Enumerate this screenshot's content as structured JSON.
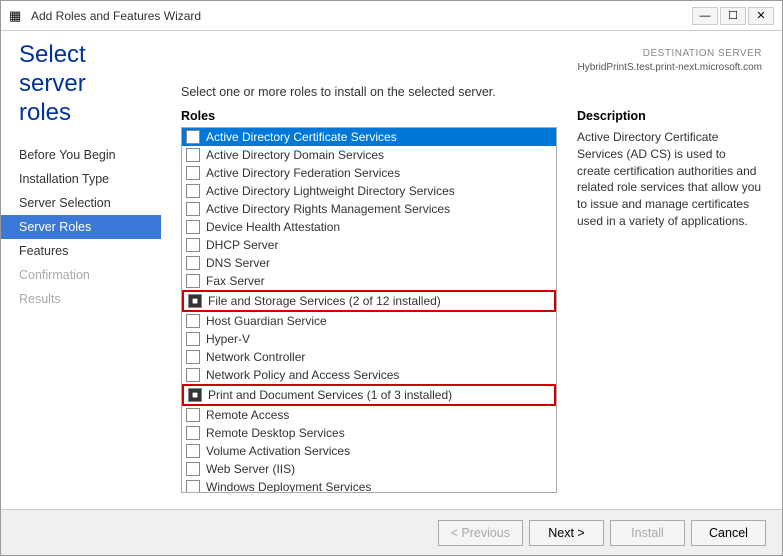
{
  "window": {
    "title": "Add Roles and Features Wizard",
    "title_icon": "▦"
  },
  "title_controls": {
    "minimize": "—",
    "maximize": "☐",
    "close": "✕"
  },
  "destination_server": {
    "label": "DESTINATION SERVER",
    "server": "HybridPrintS.test.print-next.microsoft.com"
  },
  "page_title": "Select server roles",
  "instruction": "Select one or more roles to install on the selected server.",
  "sidebar": {
    "items": [
      {
        "id": "before-you-begin",
        "label": "Before You Begin",
        "state": "normal"
      },
      {
        "id": "installation-type",
        "label": "Installation Type",
        "state": "normal"
      },
      {
        "id": "server-selection",
        "label": "Server Selection",
        "state": "normal"
      },
      {
        "id": "server-roles",
        "label": "Server Roles",
        "state": "active"
      },
      {
        "id": "features",
        "label": "Features",
        "state": "normal"
      },
      {
        "id": "confirmation",
        "label": "Confirmation",
        "state": "disabled"
      },
      {
        "id": "results",
        "label": "Results",
        "state": "disabled"
      }
    ]
  },
  "roles": {
    "column_label": "Roles",
    "items": [
      {
        "id": "ad-cert",
        "label": "Active Directory Certificate Services",
        "checked": false,
        "selected": true
      },
      {
        "id": "ad-domain",
        "label": "Active Directory Domain Services",
        "checked": false,
        "selected": false
      },
      {
        "id": "ad-federation",
        "label": "Active Directory Federation Services",
        "checked": false,
        "selected": false
      },
      {
        "id": "ad-lightweight",
        "label": "Active Directory Lightweight Directory Services",
        "checked": false,
        "selected": false
      },
      {
        "id": "ad-rights",
        "label": "Active Directory Rights Management Services",
        "checked": false,
        "selected": false
      },
      {
        "id": "device-health",
        "label": "Device Health Attestation",
        "checked": false,
        "selected": false
      },
      {
        "id": "dhcp",
        "label": "DHCP Server",
        "checked": false,
        "selected": false
      },
      {
        "id": "dns",
        "label": "DNS Server",
        "checked": false,
        "selected": false
      },
      {
        "id": "fax",
        "label": "Fax Server",
        "checked": false,
        "selected": false
      },
      {
        "id": "file-storage",
        "label": "File and Storage Services (2 of 12 installed)",
        "checked": true,
        "selected": false,
        "highlight": true
      },
      {
        "id": "host-guardian",
        "label": "Host Guardian Service",
        "checked": false,
        "selected": false
      },
      {
        "id": "hyper-v",
        "label": "Hyper-V",
        "checked": false,
        "selected": false
      },
      {
        "id": "network-controller",
        "label": "Network Controller",
        "checked": false,
        "selected": false
      },
      {
        "id": "network-policy",
        "label": "Network Policy and Access Services",
        "checked": false,
        "selected": false
      },
      {
        "id": "print-doc",
        "label": "Print and Document Services (1 of 3 installed)",
        "checked": true,
        "selected": false,
        "highlight": true
      },
      {
        "id": "remote-access",
        "label": "Remote Access",
        "checked": false,
        "selected": false
      },
      {
        "id": "remote-desktop",
        "label": "Remote Desktop Services",
        "checked": false,
        "selected": false
      },
      {
        "id": "volume-activation",
        "label": "Volume Activation Services",
        "checked": false,
        "selected": false
      },
      {
        "id": "web-server",
        "label": "Web Server (IIS)",
        "checked": false,
        "selected": false
      },
      {
        "id": "windows-deployment",
        "label": "Windows Deployment Services",
        "checked": false,
        "selected": false
      }
    ]
  },
  "description": {
    "title": "Description",
    "text": "Active Directory Certificate Services (AD CS) is used to create certification authorities and related role services that allow you to issue and manage certificates used in a variety of applications."
  },
  "footer": {
    "previous_label": "< Previous",
    "next_label": "Next >",
    "install_label": "Install",
    "cancel_label": "Cancel"
  }
}
